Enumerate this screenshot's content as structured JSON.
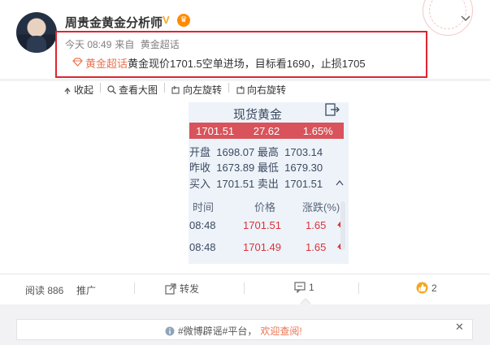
{
  "user": {
    "name": "周贵金黄金分析师",
    "verify_badge": "V"
  },
  "post": {
    "time": "今天 08:49",
    "source_prefix": "来自",
    "source": "黄金超话",
    "topic": "黄金超话",
    "text": "黄金现价1701.5空单进场，目标看1690，止损1705"
  },
  "toolbar": {
    "collapse": "收起",
    "view_large": "查看大图",
    "rotate_left": "向左旋转",
    "rotate_right": "向右旋转"
  },
  "card": {
    "title": "现货黄金",
    "price": "1701.51",
    "change": "27.62",
    "change_pct": "1.65%",
    "quotes": [
      {
        "l1": "开盘",
        "v1": "1698.07",
        "l2": "最高",
        "v2": "1703.14"
      },
      {
        "l1": "昨收",
        "v1": "1673.89",
        "l2": "最低",
        "v2": "1679.30"
      },
      {
        "l1": "买入",
        "v1": "1701.51",
        "l2": "卖出",
        "v2": "1701.51"
      }
    ],
    "table_headers": [
      "时间",
      "价格",
      "涨跌(%)"
    ],
    "trades": [
      {
        "time": "08:48",
        "price": "1701.51",
        "pct": "1.65"
      },
      {
        "time": "08:48",
        "price": "1701.49",
        "pct": "1.65"
      }
    ]
  },
  "actions": {
    "reads_label": "阅读 886",
    "promote": "推广",
    "share": "转发",
    "comments": "1",
    "likes": "2"
  },
  "notice": {
    "prefix": "#微博辟谣#平台，",
    "link": "欢迎查阅!"
  },
  "colors": {
    "highlight_border": "#e0242e",
    "topic": "#eb7350",
    "price_bar": "#d8535b"
  }
}
